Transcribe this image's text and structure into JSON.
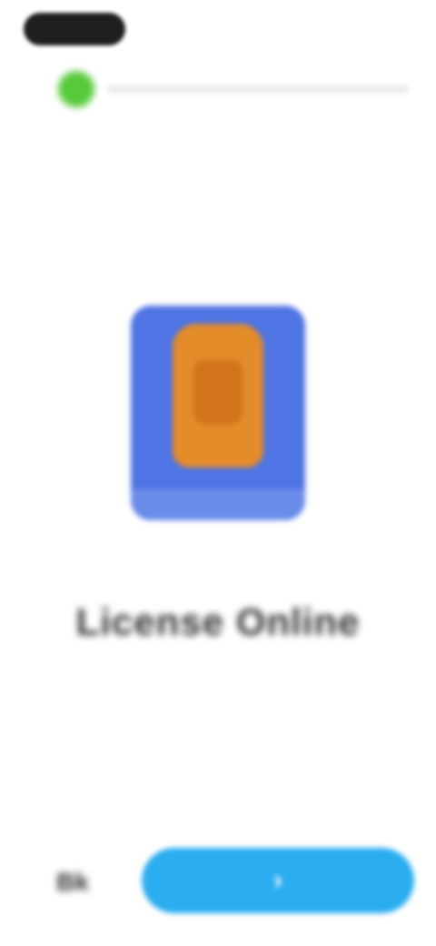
{
  "status_bar": {
    "icon": "status-pill"
  },
  "progress": {
    "step_color": "#57c93a",
    "track_color": "#eeeeee"
  },
  "app_icon": {
    "background_color": "#4f74e3",
    "badge_color": "#e48b2a",
    "icon": "license-badge-icon"
  },
  "license": {
    "label": "License Online"
  },
  "footer": {
    "back_label": "Bk",
    "next_label": "›",
    "next_color": "#2aaef0"
  }
}
